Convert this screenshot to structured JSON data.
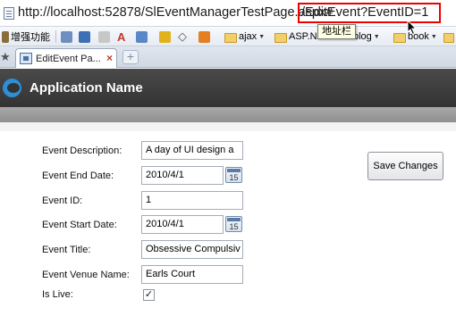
{
  "browser": {
    "url_prefix": "http://localhost:52878/SlEventManagerTestPage.aspx#",
    "url_fragment": "/EditEvent?EventID=1",
    "tooltip": "地址栏",
    "bookmarks": [
      {
        "label": "增强功能",
        "icon": "wrench-icon"
      },
      {
        "label": "",
        "icon": "folder-blue-icon"
      },
      {
        "label": "",
        "icon": "bookmark-icon"
      },
      {
        "label": "",
        "icon": "pen-icon"
      },
      {
        "label": "",
        "icon": "text-a-icon"
      },
      {
        "label": "",
        "icon": "grid-icon"
      },
      {
        "label": "",
        "icon": "shield-icon"
      },
      {
        "label": "",
        "icon": "diamond-icon"
      },
      {
        "label": "",
        "icon": "orange-shield-icon"
      },
      {
        "label": "ajax",
        "icon": "folder-icon"
      },
      {
        "label": "ASP.N",
        "icon": "folder-icon"
      },
      {
        "label": "blog",
        "icon": "folder-icon"
      },
      {
        "label": "book",
        "icon": "folder-icon"
      }
    ],
    "tab_title": "EditEvent Pa..."
  },
  "app": {
    "title": "Application Name"
  },
  "form": {
    "labels": {
      "description": "Event Description:",
      "end_date": "Event End Date:",
      "id": "Event ID:",
      "start_date": "Event Start Date:",
      "title": "Event Title:",
      "venue": "Event Venue Name:",
      "is_live": "Is Live:"
    },
    "values": {
      "description": "A day of UI design a",
      "end_date": "2010/4/1",
      "id": "1",
      "start_date": "2010/4/1",
      "title": "Obsessive Compulsiv",
      "venue": "Earls Court",
      "is_live_mark": "✓"
    },
    "calendar_glyph": "15",
    "save_label": "Save Changes"
  },
  "colors": {
    "header_bg": "#3a3a3a",
    "subheader_bg": "#999999",
    "highlight_border": "#ee0000",
    "logo": "#2d8fd8"
  }
}
